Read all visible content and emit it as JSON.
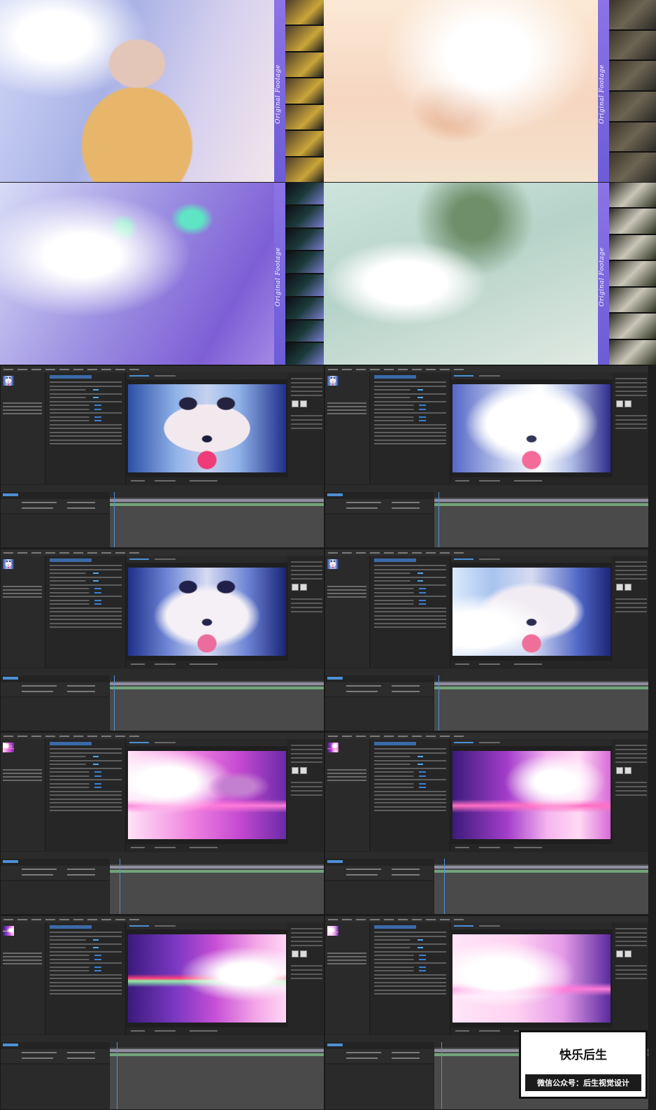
{
  "top_photos": {
    "script_text": "Original Footage"
  },
  "watermark": {
    "title": "快乐后生",
    "subtitle": "微信公众号：后生视觉设计"
  }
}
